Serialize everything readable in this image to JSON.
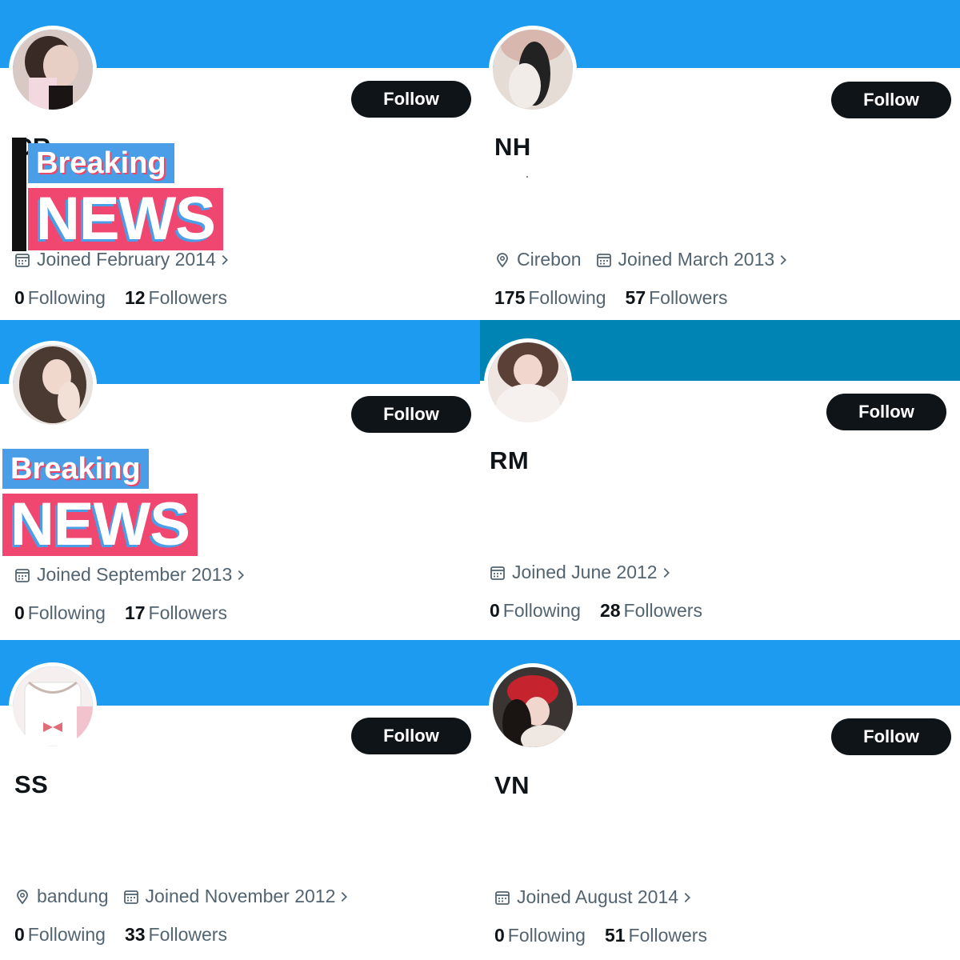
{
  "colors": {
    "banner_blue": "#1d9bf0",
    "banner_teal": "#0084b4",
    "follow_bg": "#0f1419",
    "muted_text": "#536471",
    "news_blue": "#4a9ee8",
    "news_pink": "#f04770"
  },
  "overlay": {
    "breaking": "Breaking",
    "news": "NEWS"
  },
  "cards": [
    {
      "follow_label": "Follow",
      "name": "CR",
      "joined": "Joined February 2014",
      "following_count": "0",
      "following_label": "Following",
      "followers_count": "12",
      "followers_label": "Followers"
    },
    {
      "follow_label": "Follow",
      "name": "NH",
      "location": "Cirebon",
      "joined": "Joined March 2013",
      "following_count": "175",
      "following_label": "Following",
      "followers_count": "57",
      "followers_label": "Followers"
    },
    {
      "follow_label": "Follow",
      "joined": "Joined September 2013",
      "following_count": "0",
      "following_label": "Following",
      "followers_count": "17",
      "followers_label": "Followers"
    },
    {
      "follow_label": "Follow",
      "name": "RM",
      "joined": "Joined June 2012",
      "following_count": "0",
      "following_label": "Following",
      "followers_count": "28",
      "followers_label": "Followers"
    },
    {
      "follow_label": "Follow",
      "name": "SS",
      "location": "bandung",
      "joined": "Joined November 2012",
      "following_count": "0",
      "following_label": "Following",
      "followers_count": "33",
      "followers_label": "Followers"
    },
    {
      "follow_label": "Follow",
      "name": "VN",
      "joined": "Joined August 2014",
      "following_count": "0",
      "following_label": "Following",
      "followers_count": "51",
      "followers_label": "Followers"
    }
  ]
}
